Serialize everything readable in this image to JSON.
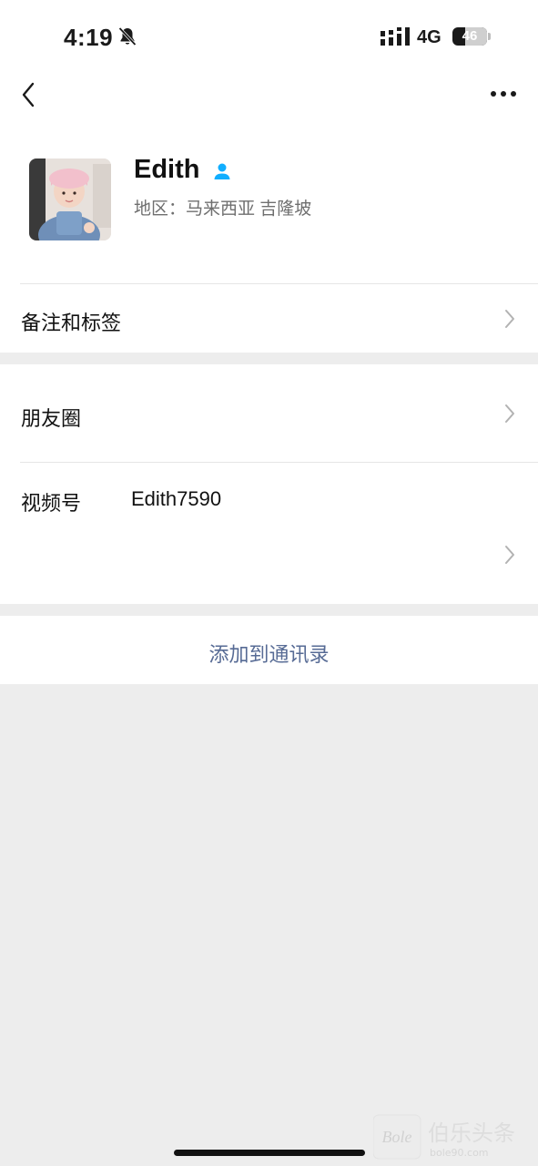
{
  "status_bar": {
    "time": "4:19",
    "network": "4G",
    "battery": "46"
  },
  "nav": {
    "back_icon": "chevron-left-icon",
    "more_icon": "more-dots-icon"
  },
  "profile": {
    "name": "Edith",
    "region": "地区：马来西亚 吉隆坡",
    "friend_badge_icon": "person-icon"
  },
  "rows": {
    "remark_tags": "备注和标签",
    "moments": "朋友圈",
    "video_channel_label": "视频号",
    "video_channel_value": "Edith7590"
  },
  "actions": {
    "add_to_contacts": "添加到通讯录"
  },
  "watermark": {
    "logo_text": "Bole",
    "brand": "伯乐头条",
    "url": "bole90.com"
  },
  "colors": {
    "link_blue": "#576b95",
    "badge_blue": "#10aeff",
    "page_bg": "#ededed"
  }
}
